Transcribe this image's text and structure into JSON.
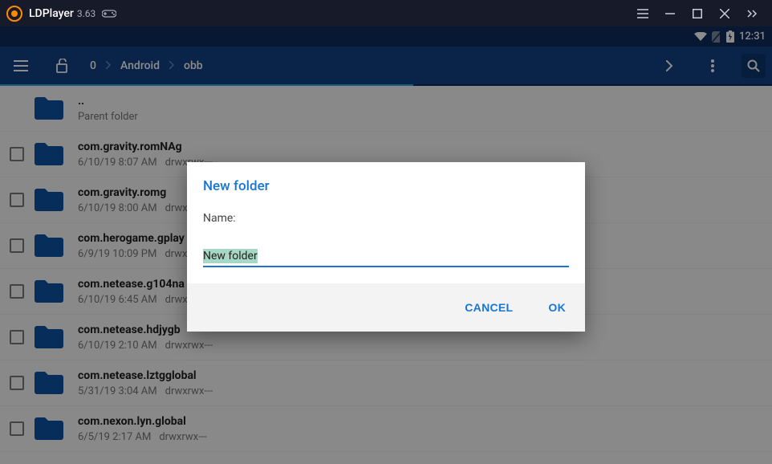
{
  "titlebar": {
    "app_name": "LDPlayer",
    "app_version": "3.63"
  },
  "statusbar": {
    "time": "12:31"
  },
  "pathbar": {
    "crumbs": [
      "0",
      "Android",
      "obb"
    ]
  },
  "files": [
    {
      "name": "..",
      "sub1": "Parent folder",
      "sub2": "",
      "checkbox": false
    },
    {
      "name": "com.gravity.romNAg",
      "sub1": "6/10/19 8:07 AM",
      "sub2": "drwxrwx---",
      "checkbox": true
    },
    {
      "name": "com.gravity.romg",
      "sub1": "6/10/19 8:00 AM",
      "sub2": "drwxrwx---",
      "checkbox": true
    },
    {
      "name": "com.herogame.gplay",
      "sub1": "6/9/19 10:09 PM",
      "sub2": "drwxrwx---",
      "checkbox": true
    },
    {
      "name": "com.netease.g104na",
      "sub1": "6/10/19 6:45 AM",
      "sub2": "drwxrwx---",
      "checkbox": true
    },
    {
      "name": "com.netease.hdjygb",
      "sub1": "6/10/19 2:10 AM",
      "sub2": "drwxrwx---",
      "checkbox": true
    },
    {
      "name": "com.netease.lztgglobal",
      "sub1": "5/31/19 3:04 AM",
      "sub2": "drwxrwx---",
      "checkbox": true
    },
    {
      "name": "com.nexon.lyn.global",
      "sub1": "6/5/19 2:17 AM",
      "sub2": "drwxrwx---",
      "checkbox": true
    }
  ],
  "dialog": {
    "title": "New folder",
    "name_label": "Name:",
    "input_value": "New folder",
    "cancel": "CANCEL",
    "ok": "OK"
  }
}
